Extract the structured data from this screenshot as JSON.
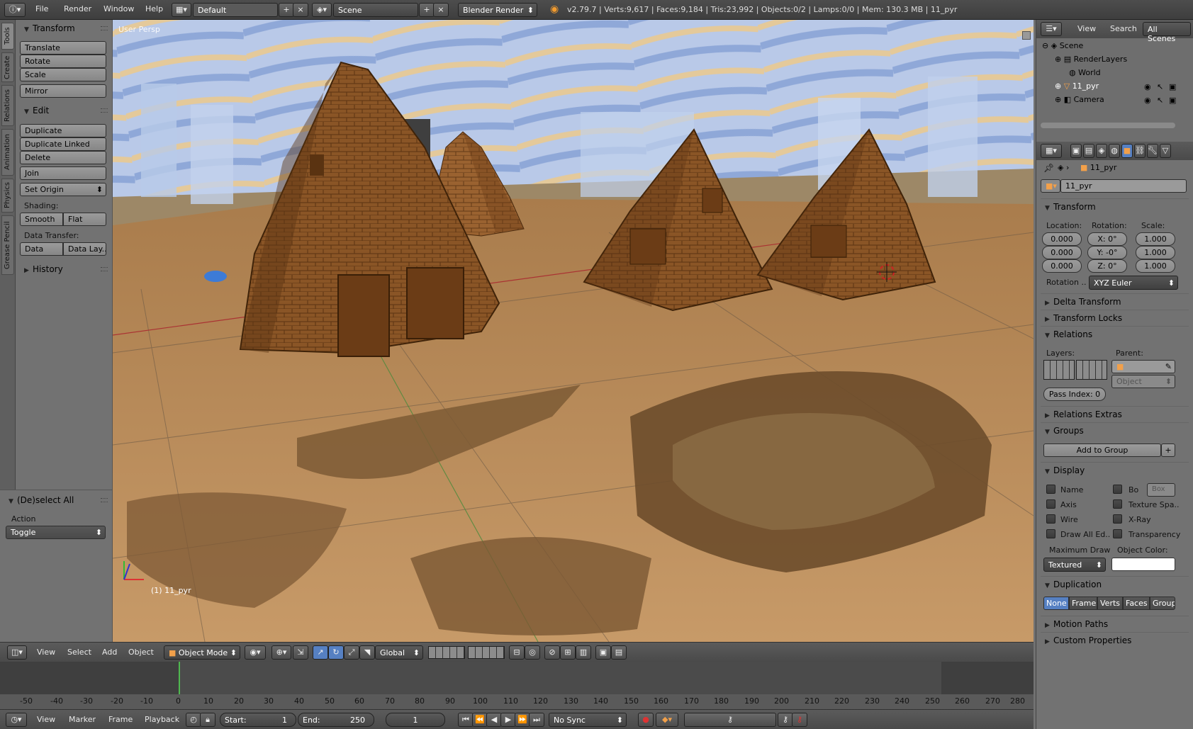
{
  "topbar": {
    "menus": [
      "File",
      "Render",
      "Window",
      "Help"
    ],
    "layout": "Default",
    "scene": "Scene",
    "engine": "Blender Render",
    "info": "v2.79.7 | Verts:9,617 | Faces:9,184 | Tris:23,992 | Objects:0/2 | Lamps:0/0 | Mem: 130.3 MB | 11_pyr"
  },
  "vtabs": [
    "Tools",
    "Create",
    "Relations",
    "Animation",
    "Physics",
    "Grease Pencil"
  ],
  "toolshelf": {
    "transform_title": "Transform",
    "translate": "Translate",
    "rotate": "Rotate",
    "scale": "Scale",
    "mirror": "Mirror",
    "edit_title": "Edit",
    "duplicate": "Duplicate",
    "duplicate_linked": "Duplicate Linked",
    "delete": "Delete",
    "join": "Join",
    "set_origin": "Set Origin",
    "shading_label": "Shading:",
    "smooth": "Smooth",
    "flat": "Flat",
    "data_transfer_label": "Data Transfer:",
    "data": "Data",
    "data_layout": "Data Lay..",
    "history_title": "History"
  },
  "redo": {
    "title": "(De)select All",
    "action_label": "Action",
    "action_value": "Toggle"
  },
  "viewport": {
    "view_name": "User Persp",
    "object_label": "(1) 11_pyr"
  },
  "viewheader": {
    "menus": [
      "View",
      "Select",
      "Add",
      "Object"
    ],
    "mode": "Object Mode",
    "orientation": "Global"
  },
  "timeline": {
    "ticks": [
      "-50",
      "-40",
      "-30",
      "-20",
      "-10",
      "0",
      "10",
      "20",
      "30",
      "40",
      "50",
      "60",
      "70",
      "80",
      "90",
      "100",
      "110",
      "120",
      "130",
      "140",
      "150",
      "160",
      "170",
      "180",
      "190",
      "200",
      "210",
      "220",
      "230",
      "240",
      "250",
      "260",
      "270",
      "280"
    ],
    "menus": [
      "View",
      "Marker",
      "Frame",
      "Playback"
    ],
    "start_label": "Start:",
    "start_value": "1",
    "end_label": "End:",
    "end_value": "250",
    "current_frame": "1",
    "sync": "No Sync"
  },
  "outliner": {
    "view": "View",
    "search": "Search",
    "all_scenes": "All Scenes",
    "items": [
      "Scene",
      "RenderLayers",
      "World",
      "11_pyr",
      "Camera"
    ]
  },
  "props": {
    "object_breadcrumb": "11_pyr",
    "object_name": "11_pyr",
    "transform_title": "Transform",
    "location_label": "Location:",
    "rotation_label": "Rotation:",
    "scale_label": "Scale:",
    "loc": [
      "0.000",
      "0.000",
      "0.000"
    ],
    "rot": [
      "X: 0°",
      "Y: -0°",
      "Z: 0°"
    ],
    "scale": [
      "1.000",
      "1.000",
      "1.000"
    ],
    "rotation_mode_label": "Rotation ..",
    "rotation_mode": "XYZ Euler",
    "delta_transform": "Delta Transform",
    "transform_locks": "Transform Locks",
    "relations": "Relations",
    "layers_label": "Layers:",
    "parent_label": "Parent:",
    "parent_type": "Object",
    "pass_index": "Pass Index: 0",
    "relations_extras": "Relations Extras",
    "groups": "Groups",
    "add_to_group": "Add to Group",
    "display": "Display",
    "disp_name": "Name",
    "disp_bo": "Bo",
    "disp_box": "Box",
    "disp_axis": "Axis",
    "disp_texture_space": "Texture Spa..",
    "disp_wire": "Wire",
    "disp_xray": "X-Ray",
    "disp_draw_all": "Draw All Ed..",
    "disp_transparency": "Transparency",
    "max_draw_label": "Maximum Draw",
    "max_draw": "Textured",
    "object_color_label": "Object Color:",
    "duplication": "Duplication",
    "dup_options": [
      "None",
      "Frames",
      "Verts",
      "Faces",
      "Group"
    ],
    "motion_paths": "Motion Paths",
    "custom_properties": "Custom Properties"
  }
}
